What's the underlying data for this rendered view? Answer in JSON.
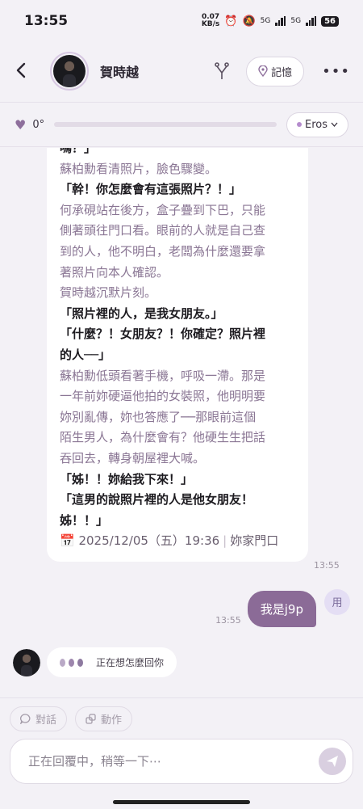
{
  "status_bar": {
    "time": "13:55",
    "speed_value": "0.07",
    "speed_unit": "KB/s",
    "network_1": "5G",
    "network_2": "5G",
    "battery": "56"
  },
  "header": {
    "back_icon": "chevron-left-icon",
    "contact_name": "賀時越",
    "branch_icon": "fork-icon",
    "memory_label": "記憶",
    "more_icon": "more-horizontal-icon"
  },
  "affection": {
    "heart_icon": "heart-icon",
    "value": "0°",
    "progress": 0,
    "mode_label": "Eros"
  },
  "message": {
    "lines": [
      {
        "text": "嗎？」",
        "style": "speech"
      },
      {
        "text": "蘇柏勳看清照片，臉色驟變。",
        "style": "narr"
      },
      {
        "text": "「幹！你怎麼會有這張照片？！」",
        "style": "speech"
      },
      {
        "text": "何承硯站在後方，盒子疊到下巴，只能",
        "style": "narr"
      },
      {
        "text": "側著頭往門口看。眼前的人就是自己查",
        "style": "narr"
      },
      {
        "text": "到的人，他不明白，老闆為什麼還要拿",
        "style": "narr"
      },
      {
        "text": "著照片向本人確認。",
        "style": "narr"
      },
      {
        "text": "賀時越沉默片刻。",
        "style": "narr"
      },
      {
        "text": "「照片裡的人，是我女朋友。」",
        "style": "speech"
      },
      {
        "text": "「什麼？！女朋友？！你確定？照片裡",
        "style": "speech"
      },
      {
        "text": "的人──」",
        "style": "speech"
      },
      {
        "text": "蘇柏勳低頭看著手機，呼吸一滯。那是",
        "style": "narr"
      },
      {
        "text": "一年前妳硬逼他拍的女裝照，他明明要",
        "style": "narr"
      },
      {
        "text": "妳別亂傳，妳也答應了──那眼前這個",
        "style": "narr"
      },
      {
        "text": "陌生男人，為什麼會有？他硬生生把話",
        "style": "narr"
      },
      {
        "text": "吞回去，轉身朝屋裡大喊。",
        "style": "narr"
      },
      {
        "text": "「姊！！妳給我下來！」",
        "style": "speech"
      },
      {
        "text": "「這男的說照片裡的人是他女朋友！",
        "style": "speech"
      },
      {
        "text": "姊！！」",
        "style": "speech"
      }
    ],
    "meta_icon": "calendar-icon",
    "meta_date": "2025/12/05（五）19:36",
    "meta_place": "妳家門口",
    "timestamp": "13:55"
  },
  "user_message": {
    "text": "我是j9p",
    "timestamp": "13:55",
    "avatar_label": "用"
  },
  "typing": {
    "text": "正在想怎麼回你"
  },
  "bottom": {
    "tab_dialogue": "對話",
    "tab_action": "動作",
    "input_placeholder": "正在回覆中，稍等一下⋯",
    "send_icon": "send-icon"
  }
}
